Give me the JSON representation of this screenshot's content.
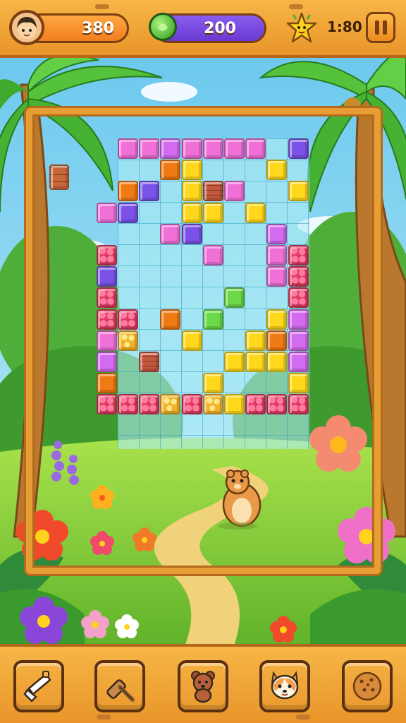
{
  "hud": {
    "score": "380",
    "gems": "200",
    "timer": "1:80"
  },
  "icons": {
    "avatar": "player-avatar",
    "gem": "green-gem-icon",
    "star": "star-character-icon",
    "pause": "pause-icon"
  },
  "colors": {
    "bar": "#f0a83a",
    "score_pill": "#f7922a",
    "gem_pill": "#7b4ae2",
    "frame": "#e79e34"
  },
  "toolbar": [
    {
      "id": "hammer",
      "icon": "hammer-icon",
      "bg": "#5cc6f0"
    },
    {
      "id": "mallet",
      "icon": "mallet-icon",
      "bg": "#4fc98e"
    },
    {
      "id": "bear",
      "icon": "bear-icon",
      "bg": "#ffd21e"
    },
    {
      "id": "corgi",
      "icon": "corgi-icon",
      "bg": "#b55ae8"
    },
    {
      "id": "cookie",
      "icon": "cookie-icon",
      "bg": "#4fc24a"
    }
  ],
  "board": {
    "columns": 9,
    "rows": 15,
    "blocks": [
      {
        "c": 0,
        "r": 0,
        "t": "pink"
      },
      {
        "c": 1,
        "r": 0,
        "t": "pink"
      },
      {
        "c": 2,
        "r": 0,
        "t": "mag"
      },
      {
        "c": 3,
        "r": 0,
        "t": "pink"
      },
      {
        "c": 4,
        "r": 0,
        "t": "pink"
      },
      {
        "c": 5,
        "r": 0,
        "t": "pink"
      },
      {
        "c": 6,
        "r": 0,
        "t": "pink"
      },
      {
        "c": 8,
        "r": 0,
        "t": "violet"
      },
      {
        "c": 2,
        "r": 1,
        "t": "orange"
      },
      {
        "c": 3,
        "r": 1,
        "t": "yellow"
      },
      {
        "c": 7,
        "r": 1,
        "t": "yellow"
      },
      {
        "c": 0,
        "r": 2,
        "t": "orange"
      },
      {
        "c": 1,
        "r": 2,
        "t": "violet"
      },
      {
        "c": 3,
        "r": 2,
        "t": "yellow"
      },
      {
        "c": 4,
        "r": 2,
        "t": "brick"
      },
      {
        "c": 5,
        "r": 2,
        "t": "pink"
      },
      {
        "c": 8,
        "r": 2,
        "t": "yellow"
      },
      {
        "c": -1,
        "r": 3,
        "t": "pink"
      },
      {
        "c": 0,
        "r": 3,
        "t": "violet"
      },
      {
        "c": 3,
        "r": 3,
        "t": "yellow"
      },
      {
        "c": 4,
        "r": 3,
        "t": "yellow"
      },
      {
        "c": 6,
        "r": 3,
        "t": "yellow"
      },
      {
        "c": 2,
        "r": 4,
        "t": "pink"
      },
      {
        "c": 3,
        "r": 4,
        "t": "violet"
      },
      {
        "c": 7,
        "r": 4,
        "t": "mag"
      },
      {
        "c": -1,
        "r": 5,
        "t": "berry"
      },
      {
        "c": 4,
        "r": 5,
        "t": "pink"
      },
      {
        "c": 7,
        "r": 5,
        "t": "pink"
      },
      {
        "c": 8,
        "r": 5,
        "t": "berry"
      },
      {
        "c": -1,
        "r": 6,
        "t": "violet"
      },
      {
        "c": 7,
        "r": 6,
        "t": "pink"
      },
      {
        "c": 8,
        "r": 6,
        "t": "berry"
      },
      {
        "c": -1,
        "r": 7,
        "t": "berry"
      },
      {
        "c": 5,
        "r": 7,
        "t": "green"
      },
      {
        "c": 8,
        "r": 7,
        "t": "berry"
      },
      {
        "c": -1,
        "r": 8,
        "t": "berry"
      },
      {
        "c": 0,
        "r": 8,
        "t": "berry"
      },
      {
        "c": 2,
        "r": 8,
        "t": "orange"
      },
      {
        "c": 4,
        "r": 8,
        "t": "green"
      },
      {
        "c": 7,
        "r": 8,
        "t": "yellow"
      },
      {
        "c": 8,
        "r": 8,
        "t": "mag"
      },
      {
        "c": -1,
        "r": 9,
        "t": "pink"
      },
      {
        "c": 0,
        "r": 9,
        "t": "honey"
      },
      {
        "c": 3,
        "r": 9,
        "t": "yellow"
      },
      {
        "c": 6,
        "r": 9,
        "t": "yellow"
      },
      {
        "c": 7,
        "r": 9,
        "t": "orange"
      },
      {
        "c": 8,
        "r": 9,
        "t": "mag"
      },
      {
        "c": -1,
        "r": 10,
        "t": "mag"
      },
      {
        "c": 1,
        "r": 10,
        "t": "brick"
      },
      {
        "c": 5,
        "r": 10,
        "t": "yellow"
      },
      {
        "c": 6,
        "r": 10,
        "t": "yellow"
      },
      {
        "c": 7,
        "r": 10,
        "t": "yellow"
      },
      {
        "c": 8,
        "r": 10,
        "t": "mag"
      },
      {
        "c": -1,
        "r": 11,
        "t": "orange"
      },
      {
        "c": 4,
        "r": 11,
        "t": "yellow"
      },
      {
        "c": 8,
        "r": 11,
        "t": "yellow"
      },
      {
        "c": -1,
        "r": 12,
        "t": "berry"
      },
      {
        "c": 0,
        "r": 12,
        "t": "berry"
      },
      {
        "c": 1,
        "r": 12,
        "t": "berry"
      },
      {
        "c": 2,
        "r": 12,
        "t": "honey"
      },
      {
        "c": 3,
        "r": 12,
        "t": "berry"
      },
      {
        "c": 4,
        "r": 12,
        "t": "honey"
      },
      {
        "c": 5,
        "r": 12,
        "t": "yellow"
      },
      {
        "c": 6,
        "r": 12,
        "t": "berry"
      },
      {
        "c": 7,
        "r": 12,
        "t": "berry"
      },
      {
        "c": 8,
        "r": 12,
        "t": "berry"
      }
    ],
    "loose_block": {
      "t": "choco"
    }
  }
}
